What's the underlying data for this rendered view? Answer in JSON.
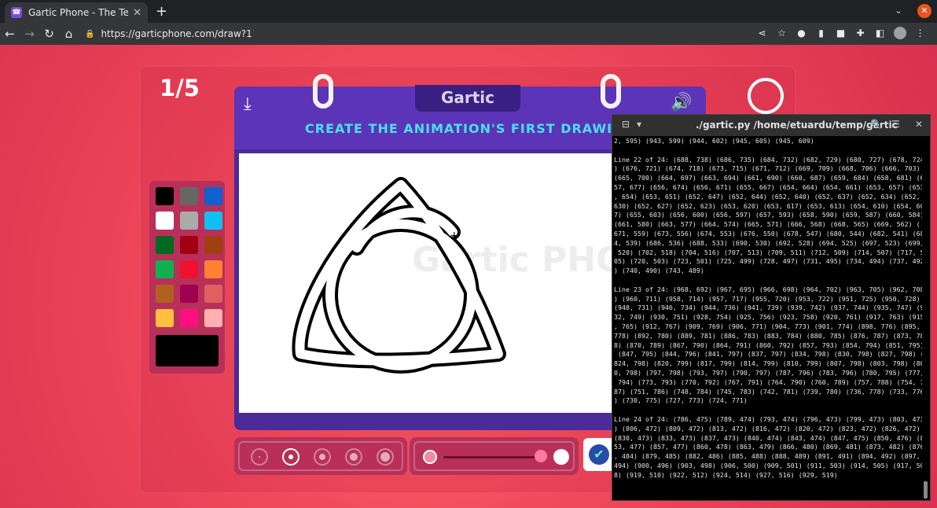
{
  "browser": {
    "tab_title": "Gartic Phone - The Telephone",
    "url": "https://garticphone.com/draw?1"
  },
  "game": {
    "round": "1/5",
    "logo": "Gartic",
    "instruction": "CREATE THE ANIMATION'S FIRST DRAWING",
    "watermark": "Gartic PHONE",
    "colors": [
      "#000000",
      "#666666",
      "#1060d0",
      "#ffffff",
      "#aaaaaa",
      "#10c0f0",
      "#006a20",
      "#a00010",
      "#a04010",
      "#10b050",
      "#f01030",
      "#ff8030",
      "#b06020",
      "#a00050",
      "#e06060",
      "#ffc040",
      "#ff1080",
      "#ffb0b0"
    ],
    "selected_color": "#000000"
  },
  "terminal": {
    "title": "./gartic.py /home/etuardu/temp/gartic",
    "lines": [
      "2, 595) (943, 599) (944, 602) (945, 605) (945, 609)",
      "",
      "Line 22 of 24: (688, 738) (686, 735) (684, 732) (682, 729) (680, 727) (678, 724",
      ") (676, 721) (674, 718) (673, 715) (671, 712) (669, 709) (668, 706) (666, 703) ",
      "(665, 700) (664, 697) (663, 694) (661, 690) (660, 687) (659, 684) (658, 681) (6",
      "57, 677) (656, 674) (656, 671) (655, 667) (654, 664) (654, 661) (653, 657) (653",
      ", 654) (653, 651) (652, 647) (652, 644) (652, 640) (652, 637) (652, 634) (652, ",
      "630) (652, 627) (652, 623) (653, 620) (653, 617) (653, 613) (654, 610) (654, 60",
      "7) (655, 603) (656, 600) (656, 597) (657, 593) (658, 590) (659, 587) (660, 584) ",
      "(661, 580) (663, 577) (664, 574) (665, 571) (666, 568) (668, 565) (669, 562) (",
      "671, 559) (673, 556) (674, 553) (676, 550) (678, 547) (680, 544) (682, 541) (68",
      "4, 539) (686, 536) (688, 533) (690, 530) (692, 528) (694, 525) (697, 523) (699,",
      " 520) (702, 518) (704, 516) (707, 513) (709, 511) (712, 509) (714, 507) (717, 5",
      "05) (720, 503) (723, 501) (725, 499) (728, 497) (731, 495) (734, 494) (737, 492",
      ") (740, 490) (743, 489)",
      "",
      "Line 23 of 24: (968, 692) (967, 695) (966, 698) (964, 702) (963, 705) (962, 708",
      ") (960, 711) (958, 714) (957, 717) (955, 720) (953, 722) (951, 725) (950, 728) ",
      "(948, 731) (946, 734) (944, 736) (941, 739) (939, 742) (937, 744) (935, 747) (9",
      "32, 749) (930, 751) (928, 754) (925, 756) (923, 758) (920, 761) (917, 763) (915",
      ", 765) (912, 767) (909, 769) (906, 771) (904, 773) (901, 774) (898, 776) (895, ",
      "778) (892, 780) (889, 781) (886, 783) (883, 784) (880, 785) (876, 787) (873, 78",
      "8) (870, 789) (867, 790) (864, 791) (860, 792) (857, 793) (854, 794) (851, 795)",
      " (847, 795) (844, 796) (841, 797) (837, 797) (834, 798) (830, 798) (827, 798) (",
      "824, 798) (820, 799) (817, 799) (814, 799) (810, 799) (807, 798) (803, 798) (80",
      "0, 798) (797, 798) (793, 797) (790, 797) (787, 796) (783, 796) (780, 795) (777,",
      " 794) (773, 793) (770, 792) (767, 791) (764, 790) (760, 789) (757, 788) (754, 7",
      "87) (751, 786) (748, 784) (745, 783) (742, 781) (739, 780) (736, 778) (733, 776",
      ") (730, 775) (727, 773) (724, 771)",
      "",
      "Line 24 of 24: (786, 475) (789, 474) (793, 474) (796, 473) (799, 473) (803, 473",
      ") (806, 472) (809, 472) (813, 472) (816, 472) (820, 472) (823, 472) (826, 472) ",
      "(830, 473) (833, 473) (837, 473) (840, 474) (843, 474) (847, 475) (850, 476) (8",
      "53, 477) (857, 477) (860, 478) (863, 479) (866, 480) (869, 481) (873, 482) (876",
      ", 484) (879, 485) (882, 486) (885, 488) (888, 489) (891, 491) (894, 492) (897, ",
      "494) (900, 496) (903, 498) (906, 500) (909, 501) (911, 503) (914, 505) (917, 50",
      "8) (919, 510) (922, 512) (924, 514) (927, 516) (929, 519)"
    ]
  }
}
